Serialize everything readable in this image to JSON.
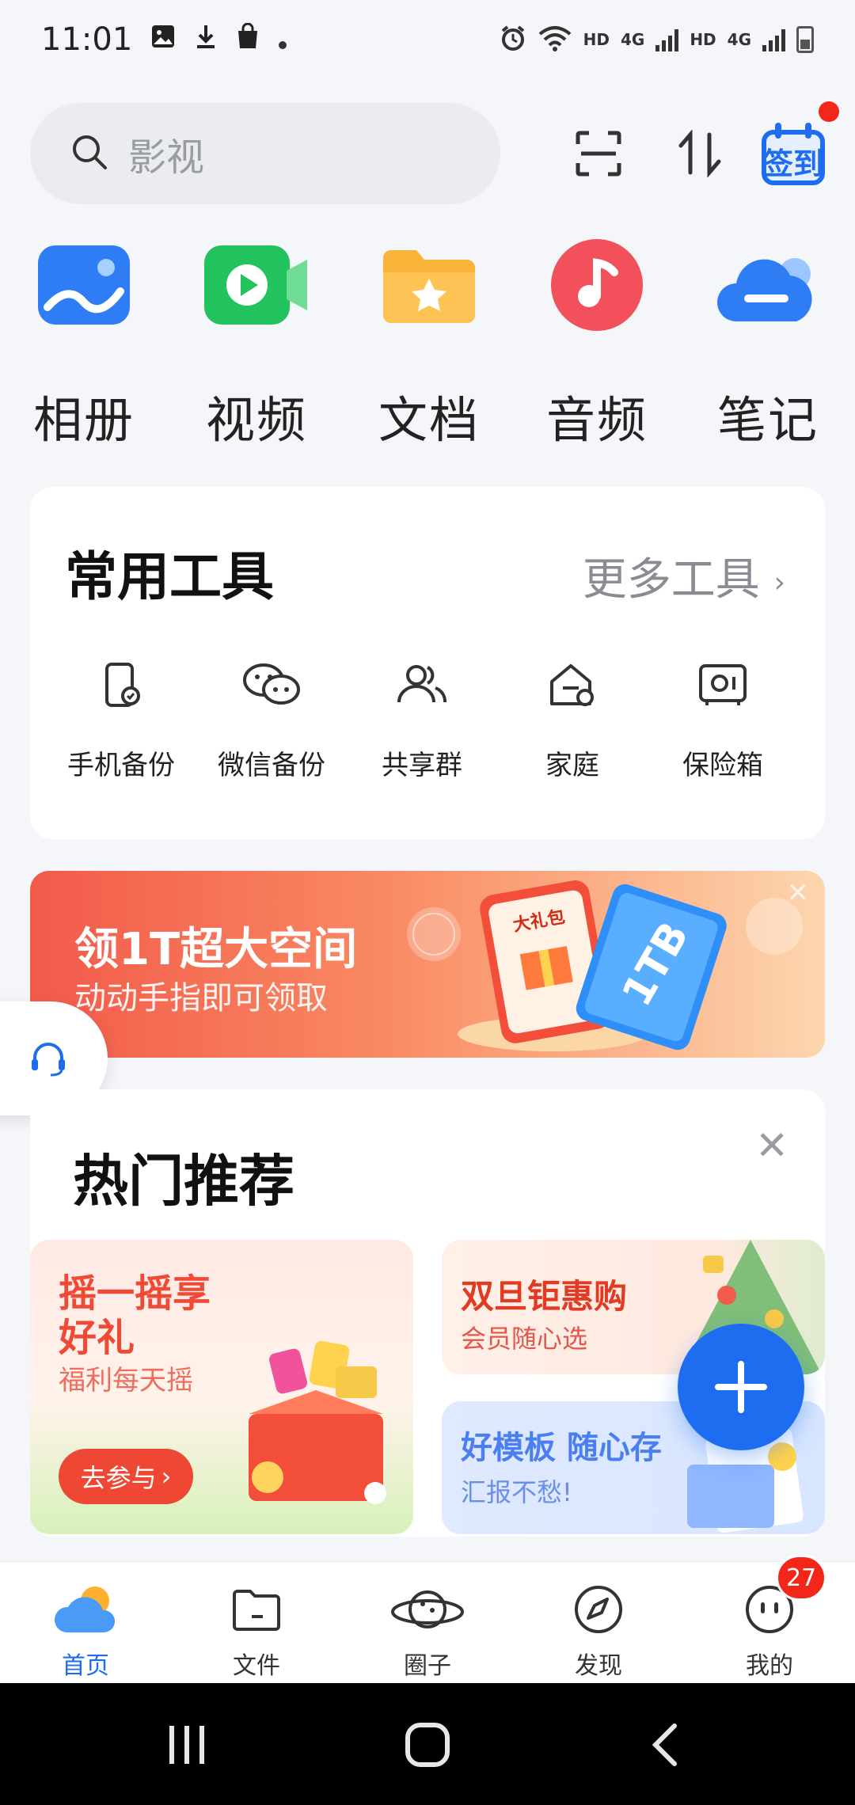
{
  "status_bar": {
    "time": "11:01",
    "hd1": "HD",
    "net1": "4G",
    "hd2": "HD",
    "net2": "4G"
  },
  "search": {
    "placeholder": "影视"
  },
  "top_actions": {
    "sign_in_label": "签到"
  },
  "categories": [
    {
      "label": "相册",
      "icon": "photo-album-icon",
      "color": "#2f7df5"
    },
    {
      "label": "视频",
      "icon": "video-icon",
      "color": "#22c35c"
    },
    {
      "label": "文档",
      "icon": "document-folder-icon",
      "color": "#fbb43a"
    },
    {
      "label": "音频",
      "icon": "music-note-icon",
      "color": "#f2505a"
    },
    {
      "label": "笔记",
      "icon": "cloud-note-icon",
      "color": "#2f7df5"
    }
  ],
  "tools": {
    "title": "常用工具",
    "more": "更多工具",
    "items": [
      {
        "label": "手机备份",
        "icon": "phone-backup-icon"
      },
      {
        "label": "微信备份",
        "icon": "wechat-backup-icon"
      },
      {
        "label": "共享群",
        "icon": "share-group-icon"
      },
      {
        "label": "家庭",
        "icon": "family-home-icon"
      },
      {
        "label": "保险箱",
        "icon": "safe-box-icon"
      }
    ]
  },
  "banner": {
    "title": "领1T超大空间",
    "subtitle": "动动手指即可领取",
    "gift_label": "大礼包",
    "card_label": "1TB"
  },
  "hot": {
    "title": "热门推荐",
    "promo_shake": {
      "title": "摇一摇享好礼",
      "subtitle": "福利每天摇",
      "button": "去参与"
    },
    "promo_holiday": {
      "title": "双旦钜惠购",
      "subtitle": "会员随心选"
    },
    "promo_template": {
      "title": "好模板 随心存",
      "subtitle": "汇报不愁!"
    }
  },
  "bottom_nav": {
    "items": [
      {
        "label": "首页",
        "active": true
      },
      {
        "label": "文件"
      },
      {
        "label": "圈子"
      },
      {
        "label": "发现"
      },
      {
        "label": "我的"
      }
    ],
    "badge": "27"
  },
  "colors": {
    "accent": "#1e6df0",
    "badge_red": "#f2271a",
    "banner_red": "#f25a4a"
  }
}
